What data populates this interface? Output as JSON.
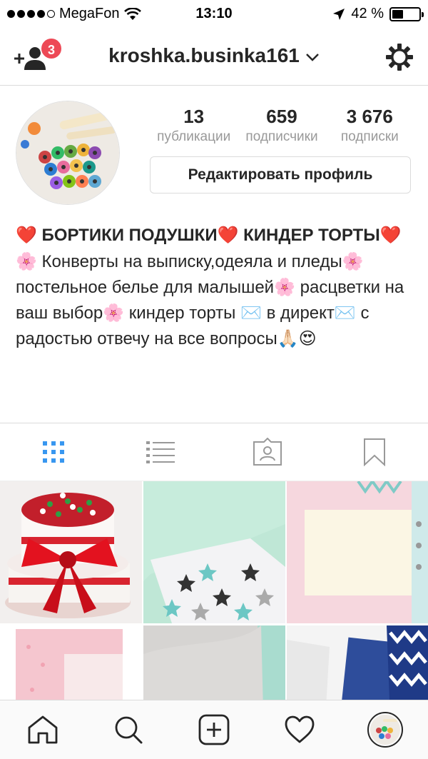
{
  "status_bar": {
    "carrier": "MegaFon",
    "time": "13:10",
    "battery": "42 %",
    "battery_level": 0.42,
    "signal_dots_filled": 4
  },
  "header": {
    "notification_count": "3",
    "username": "kroshka.businka161",
    "icons": [
      "add-user-icon",
      "chevron-down-icon",
      "gear-icon"
    ]
  },
  "profile": {
    "stats": [
      {
        "value": "13",
        "label": "публикации"
      },
      {
        "value": "659",
        "label": "подписчики"
      },
      {
        "value": "3 676",
        "label": "подписки"
      }
    ],
    "edit_button": "Редактировать профиль",
    "bio_title": "❤️ БОРТИКИ ПОДУШКИ❤️ КИНДЕР ТОРТЫ❤️",
    "bio_text": "🌸 Конверты на выписку,одеяла и пледы🌸 постельное белье для малышей🌸 расцветки на ваш выбор🌸 киндер торты ✉️ в директ✉️  с радостью отвечу на все вопросы🙏🏻😍"
  },
  "tabs": [
    "grid-icon",
    "list-icon",
    "tagged-icon",
    "bookmark-icon"
  ],
  "bottom_nav": [
    "home-icon",
    "search-icon",
    "add-post-icon",
    "heart-icon",
    "profile-avatar"
  ],
  "colors": {
    "badge": "#ed4956",
    "active_tab": "#3897f0",
    "divider": "#dbdbdb",
    "muted_text": "#999999"
  }
}
